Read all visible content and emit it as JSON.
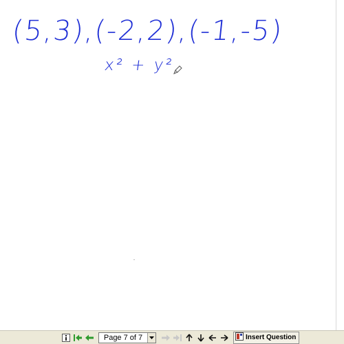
{
  "whiteboard": {
    "points_text": "(5,3),(-2,2),(-1,-5)",
    "expression_text": "x² + y²"
  },
  "toolbar": {
    "page_label": "Page 7 of 7",
    "insert_question_label": "Insert Question",
    "icons": [
      "info-icon",
      "first-page-icon",
      "previous-page-icon",
      "next-page-icon",
      "last-page-icon",
      "arrow-up-icon",
      "arrow-down-icon",
      "arrow-left-icon",
      "arrow-right-icon",
      "insert-question-icon"
    ]
  },
  "colors": {
    "ink": "#1f2fd6",
    "toolbar_bg": "#ece9d8",
    "nav_green": "#2e9b2e"
  }
}
